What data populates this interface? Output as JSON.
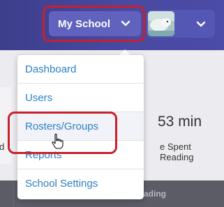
{
  "header": {
    "school_button_label": "My School",
    "chevron_icon": "chevron-down-icon",
    "avatar_icon": "avatar",
    "colors": {
      "topbar": "#4a4aa2",
      "school_button": "#6062bd",
      "highlight_outline": "#c8202c"
    }
  },
  "menu": {
    "items": [
      {
        "label": "Dashboard"
      },
      {
        "label": "Users"
      },
      {
        "label": "Rosters/Groups",
        "hovered": true
      },
      {
        "label": "Reports"
      },
      {
        "label": "School Settings"
      }
    ],
    "link_color": "#2c7fc2"
  },
  "stats": {
    "time_value": "53 min",
    "time_label": "e Spent Reading",
    "left_fragment": "d"
  },
  "bottom_bar": {
    "column_fragment": "ading"
  }
}
